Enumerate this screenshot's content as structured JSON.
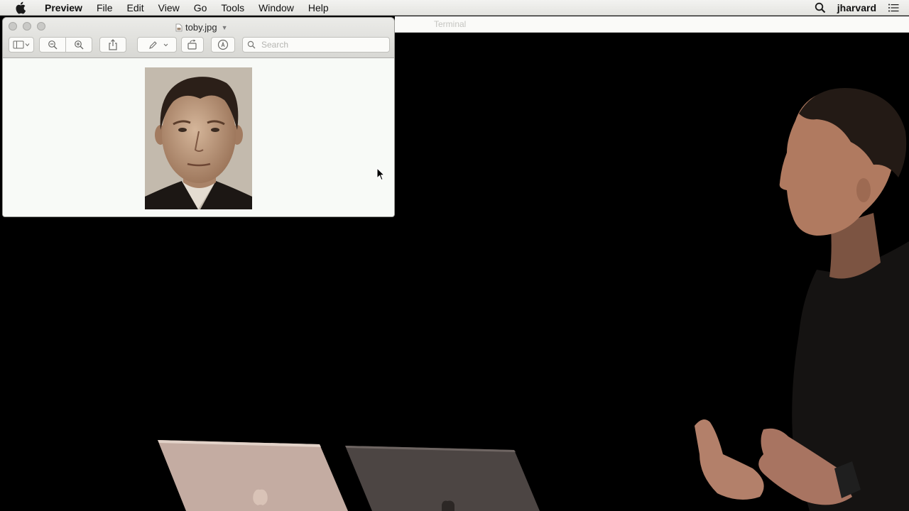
{
  "menubar": {
    "app_name": "Preview",
    "items": [
      "File",
      "Edit",
      "View",
      "Go",
      "Tools",
      "Window",
      "Help"
    ],
    "user_name": "jharvard"
  },
  "background_window": {
    "title": "Terminal"
  },
  "preview_window": {
    "title": "toby.jpg",
    "search_placeholder": "Search"
  },
  "icons": {
    "apple": "apple-logo-icon",
    "spotlight": "search-icon",
    "notifications": "list-icon",
    "sidebar": "sidebar-toggle-icon",
    "zoom_out": "zoom-out-icon",
    "zoom_in": "zoom-in-icon",
    "share": "share-icon",
    "markup": "pen-icon",
    "rotate": "rotate-icon",
    "annotate": "annotate-icon"
  },
  "colors": {
    "menubar_bg": "#e9e9e6",
    "window_bg": "#f8faf7",
    "stage_bg": "#000000",
    "laptop_silver": "#c4aca2",
    "laptop_gray": "#4c4543"
  }
}
